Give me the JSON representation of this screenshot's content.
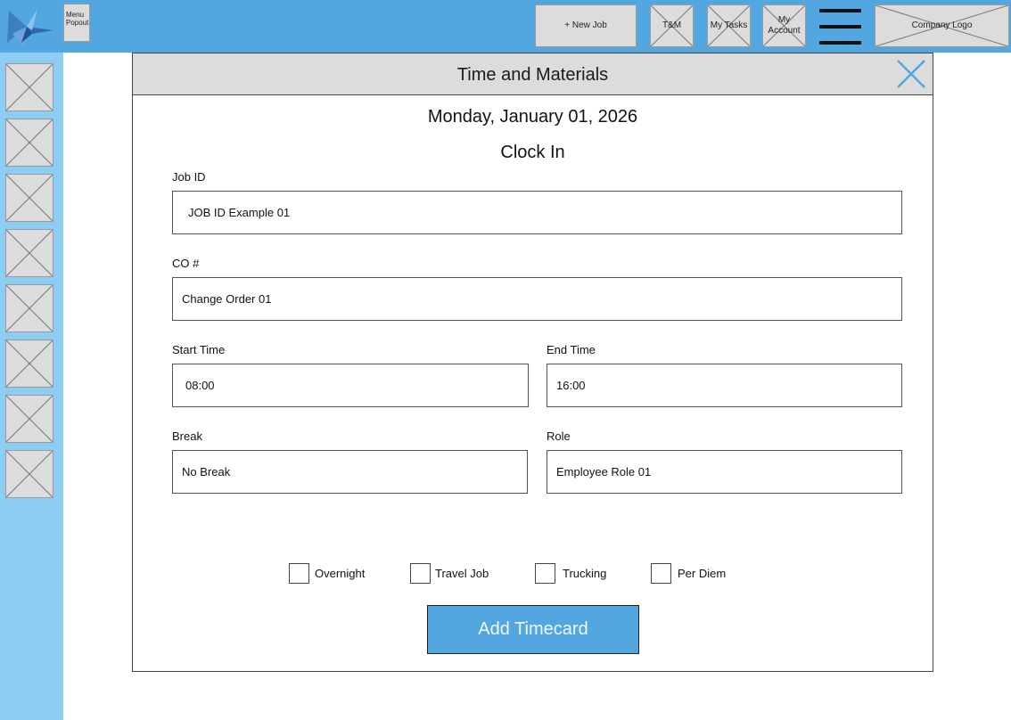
{
  "header": {
    "menu_popout_label": "Menu Popout",
    "new_job_label": "+ New Job",
    "tm_label": "T&M",
    "my_tasks_label": "My Tasks",
    "my_account_label": "My Account",
    "company_logo_label": "Company Logo",
    "logo_icon": "app-logo-icon",
    "menu_icon": "hamburger-menu-icon"
  },
  "sidebar": {
    "items": [
      "placeholder-icon",
      "placeholder-icon",
      "placeholder-icon",
      "placeholder-icon",
      "placeholder-icon",
      "placeholder-icon",
      "placeholder-icon",
      "placeholder-icon"
    ]
  },
  "modal": {
    "title": "Time and Materials",
    "close_icon": "close-icon",
    "date": "Monday, January 01, 2026",
    "subtitle": "Clock In",
    "fields": {
      "job_id": {
        "label": "Job ID",
        "value": "JOB ID Example 01"
      },
      "co": {
        "label": "CO #",
        "value": "Change Order 01"
      },
      "start_time": {
        "label": "Start Time",
        "value": "08:00"
      },
      "end_time": {
        "label": "End Time",
        "value": "16:00"
      },
      "break": {
        "label": "Break",
        "value": "No Break"
      },
      "role": {
        "label": "Role",
        "value": "Employee Role 01"
      }
    },
    "checkboxes": [
      {
        "label": "Overnight",
        "checked": false
      },
      {
        "label": "Travel Job",
        "checked": false
      },
      {
        "label": "Trucking",
        "checked": false
      },
      {
        "label": "Per Diem",
        "checked": false
      }
    ],
    "submit_label": "Add Timecard"
  },
  "colors": {
    "topbar": "#52a7e0",
    "sidebar": "#8ccdf3",
    "placeholder": "#dcdcdc",
    "accent_button": "#52a7e0"
  }
}
